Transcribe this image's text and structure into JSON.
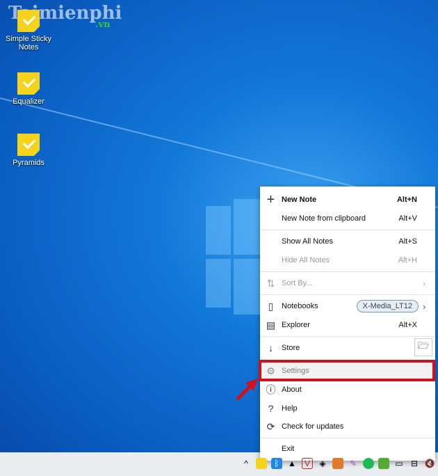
{
  "watermark": {
    "text": "Taimienphi",
    "suffix": ".vn"
  },
  "desktop_icons": [
    {
      "label": "Simple Sticky Notes"
    },
    {
      "label": "Equalizer"
    },
    {
      "label": "Pyramids"
    }
  ],
  "menu": {
    "new_note": {
      "label": "New Note",
      "shortcut": "Alt+N"
    },
    "new_from_clipboard": {
      "label": "New Note from clipboard",
      "shortcut": "Alt+V"
    },
    "show_all": {
      "label": "Show All Notes",
      "shortcut": "Alt+S"
    },
    "hide_all": {
      "label": "Hide All Notes",
      "shortcut": "Alt+H"
    },
    "sort_by": {
      "label": "Sort By..."
    },
    "notebooks": {
      "label": "Notebooks",
      "badge": "X-Media_LT12"
    },
    "explorer": {
      "label": "Explorer",
      "shortcut": "Alt+X"
    },
    "store": {
      "label": "Store"
    },
    "settings": {
      "label": "Settings"
    },
    "about": {
      "label": "About"
    },
    "help": {
      "label": "Help"
    },
    "check_updates": {
      "label": "Check for updates"
    },
    "exit": {
      "label": "Exit"
    }
  },
  "highlight_color": "#d2111c"
}
